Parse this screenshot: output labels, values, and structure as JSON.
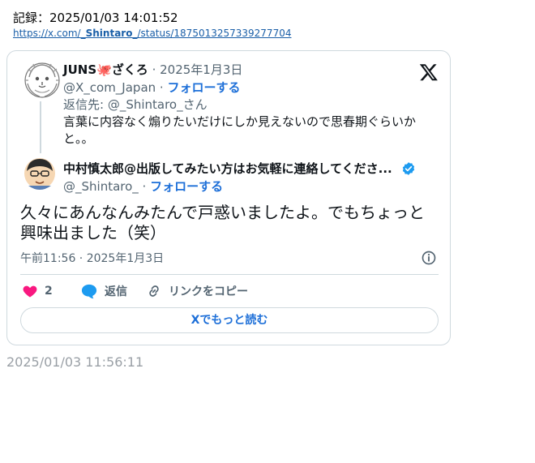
{
  "record": {
    "text": "記録：2025/01/03 14:01:52"
  },
  "url": {
    "prefix": "https://x.com/",
    "user": "_Shintaro_",
    "suffix": "/status/1875013257339277704"
  },
  "reply": {
    "name": "JUNS🐙ざくろ",
    "date": "· 2025年1月3日",
    "handle": "@X_com_Japan ·",
    "follow": "フォローする",
    "replying_to": "返信先: @_Shintaro_さん",
    "text": "言葉に内容なく煽りたいだけにしか見えないので思春期ぐらいかと。。"
  },
  "main": {
    "name": "中村慎太郎@出版してみたい方はお気軽に連絡してくださ...",
    "handle": "@_Shintaro_ ·",
    "follow": "フォローする",
    "text": "久々にあんなんみたんで戸惑いましたよ。でもちょっと興味出ました（笑）",
    "timestamp": "午前11:56 · 2025年1月3日"
  },
  "actions": {
    "likes": "2",
    "reply_label": "返信",
    "copy_label": "リンクをコピー"
  },
  "read_more": "Xでもっと読む",
  "bottom_timestamp": "2025/01/03 11:56:11",
  "colors": {
    "accent": "#1d6fd8",
    "like": "#f91880",
    "reply": "#1d9bf0",
    "verified": "#1d9bf0",
    "muted": "#536471",
    "border": "#cfd9de"
  },
  "icons": [
    "x-logo-icon",
    "verified-icon",
    "info-icon",
    "heart-icon",
    "reply-bubble-icon",
    "link-icon"
  ]
}
